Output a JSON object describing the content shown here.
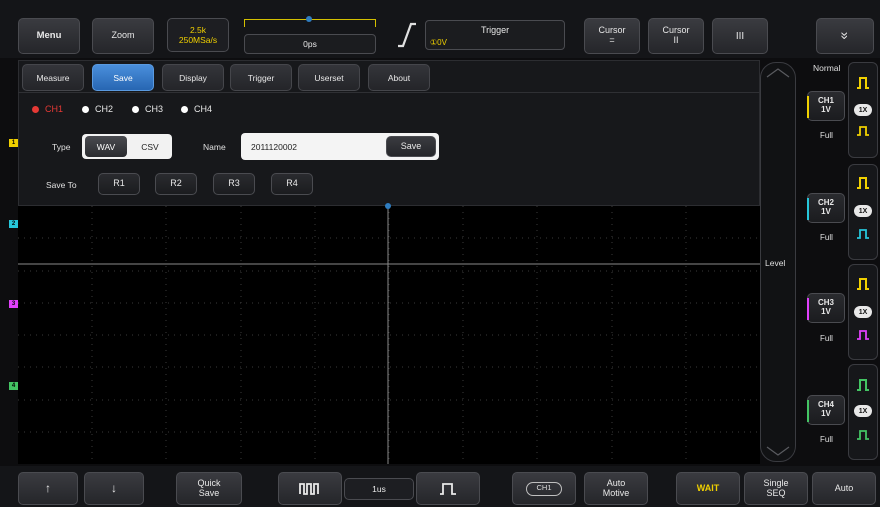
{
  "toolbar": {
    "menu_label": "Menu",
    "zoom_label": "Zoom",
    "timebase_rate": "2.5k",
    "sample_rate": "250MSa/s",
    "horizontal_position": "0ps",
    "trigger_title": "Trigger",
    "trigger_level": "①0V",
    "cursor1_title": "Cursor",
    "cursor1_sub": "=",
    "cursor2_title": "Cursor",
    "cursor2_sub": "II",
    "bars_label": "III",
    "collapse_label": "»"
  },
  "tabs": [
    "Measure",
    "Save",
    "Display",
    "Trigger",
    "Userset",
    "About"
  ],
  "active_tab": "Save",
  "save_panel": {
    "channels": [
      "CH1",
      "CH2",
      "CH3",
      "CH4"
    ],
    "selected_channel": "CH1",
    "type_label": "Type",
    "type_options": [
      "WAV",
      "CSV"
    ],
    "type_selected": "WAV",
    "name_label": "Name",
    "name_value": "2011120002",
    "save_button": "Save",
    "save_to_label": "Save To",
    "refs": [
      "R1",
      "R2",
      "R3",
      "R4"
    ]
  },
  "level_label": "Level",
  "right_panel": {
    "mode": "Normal",
    "channels": [
      {
        "name": "CH1",
        "scale": "1V",
        "coupling": "Full",
        "probe": "1X",
        "color": "#f0d000"
      },
      {
        "name": "CH2",
        "scale": "1V",
        "coupling": "Full",
        "probe": "1X",
        "color": "#26c6da"
      },
      {
        "name": "CH3",
        "scale": "1V",
        "coupling": "Full",
        "probe": "1X",
        "color": "#e040fb"
      },
      {
        "name": "CH4",
        "scale": "1V",
        "coupling": "Full",
        "probe": "1X",
        "color": "#43c463"
      }
    ]
  },
  "bottom": {
    "up_label": "↑",
    "down_label": "↓",
    "quick_save_1": "Quick",
    "quick_save_2": "Save",
    "timebase": "1us",
    "ch1_badge": "CH1",
    "auto_motive_1": "Auto",
    "auto_motive_2": "Motive",
    "run_state": "WAIT",
    "single_1": "Single",
    "single_2": "SEQ",
    "auto_label": "Auto"
  },
  "colors": {
    "accent": "#2f7dd0",
    "ch1": "#f0d000",
    "ch2": "#26c6da",
    "ch3": "#e040fb",
    "ch4": "#43c463",
    "record_dot": "#e53935"
  },
  "icons": [
    "pulse-wide-icon",
    "pulse-narrow-icon",
    "rising-edge-icon",
    "ch-waveform-icon"
  ]
}
